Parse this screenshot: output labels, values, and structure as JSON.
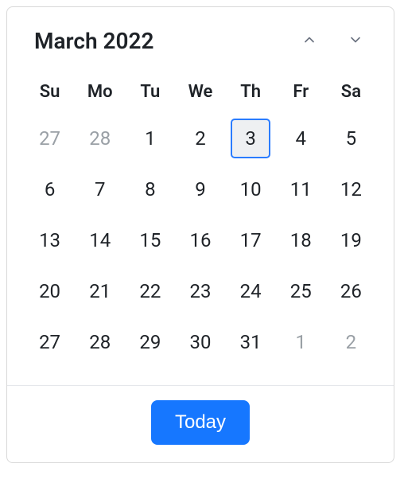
{
  "header": {
    "title": "March 2022",
    "prev_icon": "chevron-up-icon",
    "next_icon": "chevron-down-icon"
  },
  "weekdays": [
    "Su",
    "Mo",
    "Tu",
    "We",
    "Th",
    "Fr",
    "Sa"
  ],
  "weeks": [
    [
      {
        "day": "27",
        "other": true,
        "selected": false
      },
      {
        "day": "28",
        "other": true,
        "selected": false
      },
      {
        "day": "1",
        "other": false,
        "selected": false
      },
      {
        "day": "2",
        "other": false,
        "selected": false
      },
      {
        "day": "3",
        "other": false,
        "selected": true
      },
      {
        "day": "4",
        "other": false,
        "selected": false
      },
      {
        "day": "5",
        "other": false,
        "selected": false
      }
    ],
    [
      {
        "day": "6",
        "other": false,
        "selected": false
      },
      {
        "day": "7",
        "other": false,
        "selected": false
      },
      {
        "day": "8",
        "other": false,
        "selected": false
      },
      {
        "day": "9",
        "other": false,
        "selected": false
      },
      {
        "day": "10",
        "other": false,
        "selected": false
      },
      {
        "day": "11",
        "other": false,
        "selected": false
      },
      {
        "day": "12",
        "other": false,
        "selected": false
      }
    ],
    [
      {
        "day": "13",
        "other": false,
        "selected": false
      },
      {
        "day": "14",
        "other": false,
        "selected": false
      },
      {
        "day": "15",
        "other": false,
        "selected": false
      },
      {
        "day": "16",
        "other": false,
        "selected": false
      },
      {
        "day": "17",
        "other": false,
        "selected": false
      },
      {
        "day": "18",
        "other": false,
        "selected": false
      },
      {
        "day": "19",
        "other": false,
        "selected": false
      }
    ],
    [
      {
        "day": "20",
        "other": false,
        "selected": false
      },
      {
        "day": "21",
        "other": false,
        "selected": false
      },
      {
        "day": "22",
        "other": false,
        "selected": false
      },
      {
        "day": "23",
        "other": false,
        "selected": false
      },
      {
        "day": "24",
        "other": false,
        "selected": false
      },
      {
        "day": "25",
        "other": false,
        "selected": false
      },
      {
        "day": "26",
        "other": false,
        "selected": false
      }
    ],
    [
      {
        "day": "27",
        "other": false,
        "selected": false
      },
      {
        "day": "28",
        "other": false,
        "selected": false
      },
      {
        "day": "29",
        "other": false,
        "selected": false
      },
      {
        "day": "30",
        "other": false,
        "selected": false
      },
      {
        "day": "31",
        "other": false,
        "selected": false
      },
      {
        "day": "1",
        "other": true,
        "selected": false
      },
      {
        "day": "2",
        "other": true,
        "selected": false
      }
    ]
  ],
  "footer": {
    "today_label": "Today"
  },
  "colors": {
    "accent": "#1677ff",
    "selected_border": "#2a7cff",
    "muted_text": "#9aa0a6",
    "text": "#1f2328"
  }
}
